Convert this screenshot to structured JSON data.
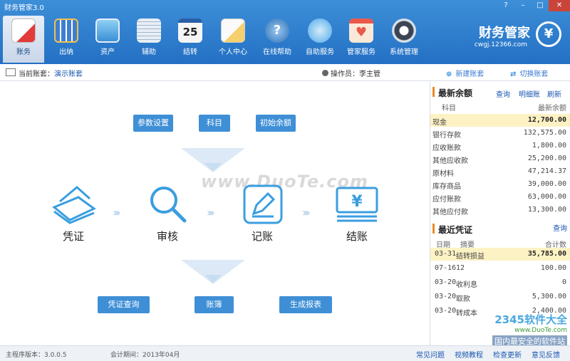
{
  "window": {
    "title": "财务管家3.0",
    "controls": [
      "?",
      "–",
      "□",
      "✕"
    ]
  },
  "toolbar": {
    "items": [
      {
        "label": "账务",
        "icon": "ledger-book-icon",
        "color": "#e23b3b"
      },
      {
        "label": "出纳",
        "icon": "calculator-icon",
        "color": "#3f7fd0"
      },
      {
        "label": "资产",
        "icon": "monitor-icon",
        "color": "#5fb0e8"
      },
      {
        "label": "辅助",
        "icon": "documents-icon",
        "color": "#9fb8cf"
      },
      {
        "label": "结转",
        "icon": "calendar-icon",
        "color": "#f0f0f0",
        "day": "25"
      },
      {
        "label": "个人中心",
        "icon": "person-document-icon",
        "color": "#f5d06c"
      },
      {
        "label": "在线帮助",
        "icon": "help-globe-icon",
        "color": "#2a6fb7"
      },
      {
        "label": "自助服务",
        "icon": "smiley-service-icon",
        "color": "#4fa8e8"
      },
      {
        "label": "管家服务",
        "icon": "heart-calendar-icon",
        "color": "#e95a4a"
      },
      {
        "label": "系统管理",
        "icon": "gear-icon",
        "color": "#3b4452"
      }
    ]
  },
  "brand": {
    "name": "财务管家",
    "url": "cwgj.12366.com",
    "logo": "¥"
  },
  "account_bar": {
    "label": "当前账套：",
    "value": "演示账套",
    "operator_label": "操作员：",
    "operator": "李主管",
    "new_label": "新建账套",
    "switch_label": "切换账套"
  },
  "flow": {
    "top_buttons": [
      "参数设置",
      "科目",
      "初始余额"
    ],
    "steps": [
      "凭证",
      "审核",
      "记账",
      "结账"
    ],
    "bottom_buttons": [
      "凭证查询",
      "账簿",
      "生成报表"
    ],
    "watermark": "www.DuoTe.com"
  },
  "balance": {
    "title": "最新余额",
    "links": [
      "查询",
      "明细账",
      "刷新"
    ],
    "col_subject": "科目",
    "col_amount": "最新余额",
    "rows": [
      {
        "name": "现金",
        "value": "12,700.00"
      },
      {
        "name": "银行存款",
        "value": "132,575.00"
      },
      {
        "name": "应收账款",
        "value": "1,800.00"
      },
      {
        "name": "其他应收款",
        "value": "25,200.00"
      },
      {
        "name": "原材料",
        "value": "47,214.37"
      },
      {
        "name": "库存商品",
        "value": "39,000.00"
      },
      {
        "name": "应付账款",
        "value": "63,000.00"
      },
      {
        "name": "其他应付款",
        "value": "13,300.00"
      }
    ]
  },
  "vouchers": {
    "title": "最近凭证",
    "link": "查询",
    "col_date": "日期",
    "col_summary": "摘要",
    "col_amount": "合计数",
    "rows": [
      {
        "date": "03-31",
        "summary": "结转损益",
        "amount": "35,785.00"
      },
      {
        "date": "07-16",
        "summary": "12",
        "amount": "100.00"
      },
      {
        "date": "03-20",
        "summary": "收利息",
        "amount": "0"
      },
      {
        "date": "03-20",
        "summary": "取款",
        "amount": "5,300.00"
      },
      {
        "date": "03-20",
        "summary": "转成本",
        "amount": "2,400.00"
      }
    ]
  },
  "status": {
    "version": "主程序版本：3.0.0.5",
    "period": "会计期间：2013年04月",
    "links": [
      "常见问题",
      "视频教程",
      "检查更新",
      "意见反馈"
    ]
  },
  "corner_watermark": {
    "brand": "2345软件大全",
    "url": "www.DuoTe.com",
    "slogan": "国内最安全的软件站"
  }
}
